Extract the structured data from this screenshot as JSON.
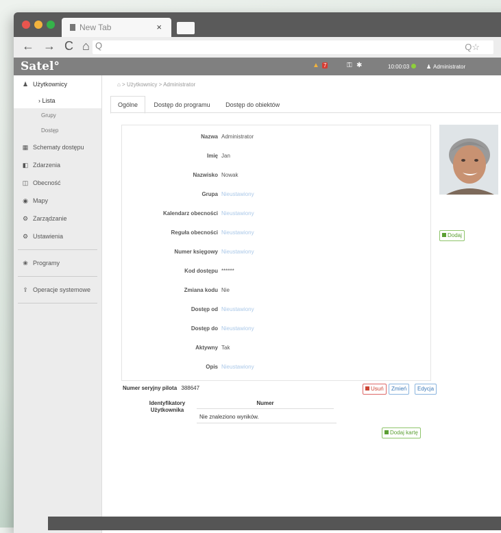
{
  "browser": {
    "tab_title": "New Tab",
    "tab_close": "×",
    "nav_glyphs": "← → C ⌂",
    "search_glyph": "Q",
    "zoom_glyphs": "Q☆",
    "menu_glyph": "≡",
    "expand_glyph": "↗"
  },
  "app": {
    "logo": "Satel°",
    "badge": "7",
    "time": "10:00:03",
    "user": "Administrator"
  },
  "sidebar": {
    "items": [
      {
        "icon": "user-icon",
        "glyph": "♟",
        "label": "Użytkownicy"
      },
      {
        "icon": "calendar-icon",
        "glyph": "▦",
        "label": "Schematy dostępu"
      },
      {
        "icon": "events-icon",
        "glyph": "◧",
        "label": "Zdarzenia"
      },
      {
        "icon": "presence-icon",
        "glyph": "◫",
        "label": "Obecność"
      },
      {
        "icon": "map-icon",
        "glyph": "◉",
        "label": "Mapy"
      },
      {
        "icon": "gears-icon",
        "glyph": "⚙",
        "label": "Zarządzanie"
      },
      {
        "icon": "settings-icon",
        "glyph": "⚙",
        "label": "Ustawienia"
      },
      {
        "icon": "programs-icon",
        "glyph": "❀",
        "label": "Programy"
      },
      {
        "icon": "system-icon",
        "glyph": "⇪",
        "label": "Operacje systemowe"
      }
    ],
    "sub": {
      "lista": "› Lista",
      "grupy": "Grupy",
      "dostep": "Dostęp"
    }
  },
  "main": {
    "breadcrumb": "⌂  >  Użytkownicy  >  Administrator",
    "tabs": [
      "Ogólne",
      "Dostęp do programu",
      "Dostęp do obiektów"
    ],
    "fields": [
      {
        "label": "Nazwa",
        "value": "Administrator",
        "unset": false
      },
      {
        "label": "Imię",
        "value": "Jan",
        "unset": false
      },
      {
        "label": "Nazwisko",
        "value": "Nowak",
        "unset": false
      },
      {
        "label": "Grupa",
        "value": "Nieustawiony",
        "unset": true
      },
      {
        "label": "Kalendarz obecności",
        "value": "Nieustawiony",
        "unset": true
      },
      {
        "label": "Reguła obecności",
        "value": "Nieustawiony",
        "unset": true
      },
      {
        "label": "Numer księgowy",
        "value": "Nieustawiony",
        "unset": true
      },
      {
        "label": "Kod dostępu",
        "value": "******",
        "unset": false
      },
      {
        "label": "Zmiana kodu",
        "value": "Nie",
        "unset": false
      },
      {
        "label": "Dostęp od",
        "value": "Nieustawiony",
        "unset": true
      },
      {
        "label": "Dostęp do",
        "value": "Nieustawiony",
        "unset": true
      },
      {
        "label": "Aktywny",
        "value": "Tak",
        "unset": false
      },
      {
        "label": "Opis",
        "value": "Nieustawiony",
        "unset": true
      }
    ],
    "add_photo": "Dodaj",
    "serial_label": "Numer seryjny pilota",
    "serial_value": "388647",
    "btn_delete": "Usuń",
    "btn_change": "Zmień",
    "btn_edit": "Edycja",
    "ids_label_1": "Identyfikatory",
    "ids_label_2": "Użytkownika",
    "ids_column": "Numer",
    "ids_empty": "Nie znaleziono wyników.",
    "btn_add_card": "Dodaj kartę"
  }
}
